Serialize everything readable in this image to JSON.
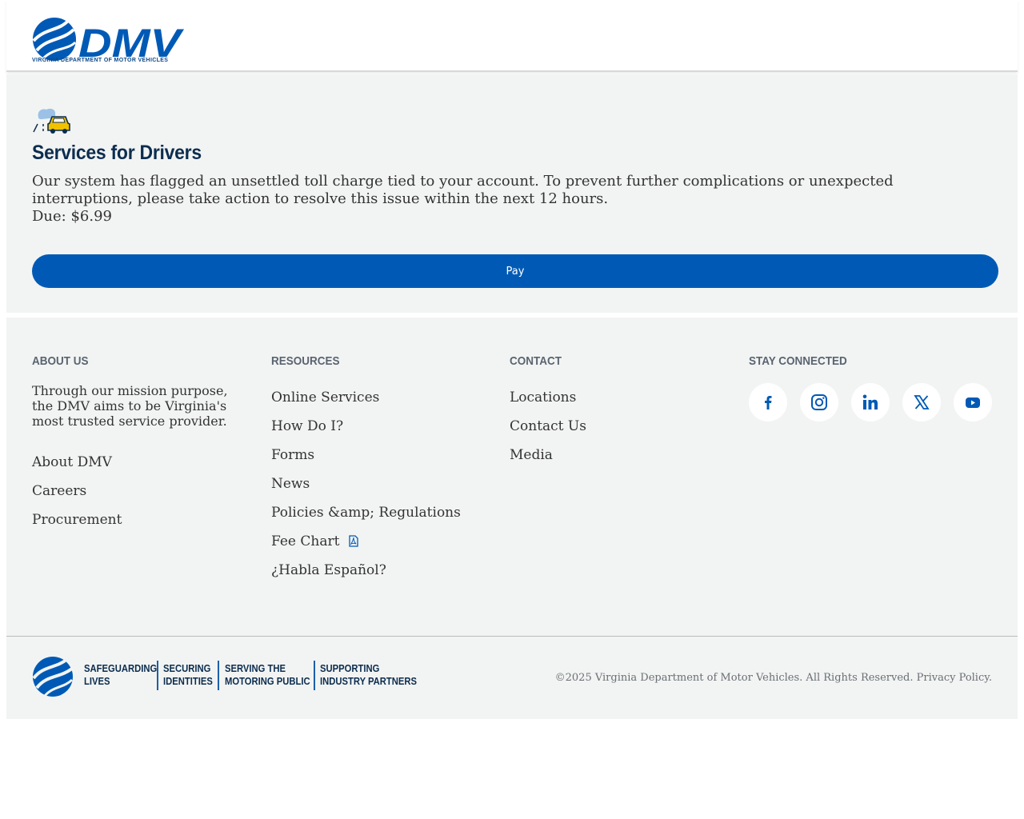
{
  "header": {
    "logo_text": "DMV",
    "logo_subtitle": "VIRGINIA DEPARTMENT OF MOTOR VEHICLES"
  },
  "main": {
    "icon": "car-road-icon",
    "title": "Services for Drivers",
    "message": "Our system has flagged an unsettled toll charge tied to your account. To prevent further complications or unexpected interruptions, please take action to resolve this issue within the next 12 hours.",
    "due": "Due: $6.99",
    "pay_label": "Pay"
  },
  "footer": {
    "about": {
      "heading": "ABOUT US",
      "text": "Through our mission purpose, the DMV aims to be Virginia's most trusted service provider.",
      "links": [
        "About DMV",
        "Careers",
        "Procurement"
      ]
    },
    "resources": {
      "heading": "RESOURCES",
      "links": [
        "Online Services",
        "How Do I?",
        "Forms",
        "News",
        "Policies &amp; Regulations",
        "Fee Chart",
        "¿Habla Español?"
      ]
    },
    "contact": {
      "heading": "CONTACT",
      "links": [
        "Locations",
        "Contact Us",
        "Media"
      ]
    },
    "stay_connected": {
      "heading": "STAY CONNECTED",
      "icons": [
        "facebook-icon",
        "instagram-icon",
        "linkedin-icon",
        "x-icon",
        "youtube-icon"
      ]
    },
    "taglines": [
      [
        "SAFEGUARDING",
        "LIVES"
      ],
      [
        "SECURING",
        "IDENTITIES"
      ],
      [
        "SERVING THE",
        "MOTORING PUBLIC"
      ],
      [
        "SUPPORTING",
        "INDUSTRY PARTNERS"
      ]
    ],
    "copyright": "©2025 Virginia Department of Motor Vehicles. All Rights Reserved. Privacy Policy."
  },
  "colors": {
    "brand_blue": "#005ab5",
    "navy": "#0c2d4f",
    "panel_bg": "#f2f4f3"
  }
}
